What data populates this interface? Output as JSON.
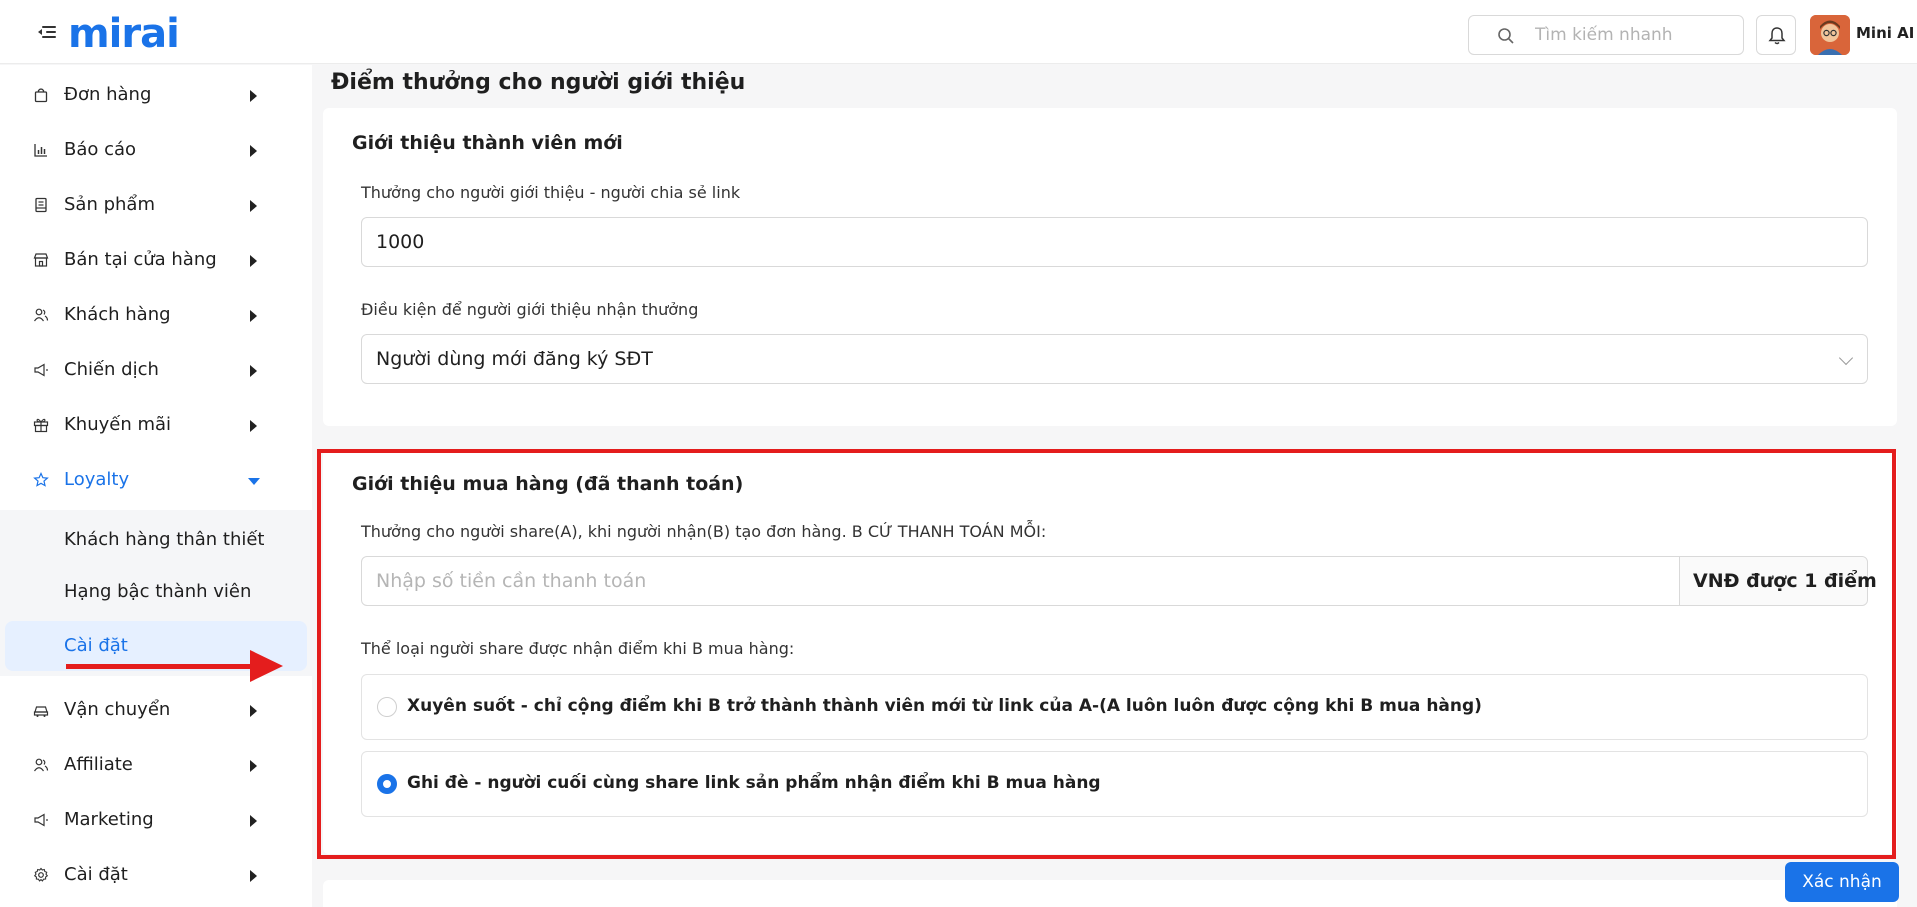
{
  "header": {
    "logo_text": "mirai",
    "search_placeholder": "Tìm kiếm nhanh",
    "user_name": "Mini AI"
  },
  "sidebar": {
    "items": [
      {
        "label": "Đơn hàng",
        "icon": "bag-icon"
      },
      {
        "label": "Báo cáo",
        "icon": "chart-icon"
      },
      {
        "label": "Sản phẩm",
        "icon": "book-icon"
      },
      {
        "label": "Bán tại cửa hàng",
        "icon": "store-icon"
      },
      {
        "label": "Khách hàng",
        "icon": "users-icon"
      },
      {
        "label": "Chiến dịch",
        "icon": "megaphone-icon"
      },
      {
        "label": "Khuyến mãi",
        "icon": "gift-icon"
      },
      {
        "label": "Loyalty",
        "icon": "star-icon"
      },
      {
        "label": "Vận chuyển",
        "icon": "car-icon"
      },
      {
        "label": "Affiliate",
        "icon": "users-icon"
      },
      {
        "label": "Marketing",
        "icon": "megaphone-icon"
      },
      {
        "label": "Cài đặt",
        "icon": "gear-icon"
      }
    ],
    "loyalty_sub": [
      {
        "label": "Khách hàng thân thiết"
      },
      {
        "label": "Hạng bậc thành viên"
      },
      {
        "label": "Cài đặt"
      }
    ]
  },
  "main": {
    "page_title": "Điểm thưởng cho người giới thiệu",
    "card1": {
      "title": "Giới thiệu thành viên mới",
      "reward_label": "Thưởng cho người giới thiệu - người chia sẻ link",
      "reward_value": "1000",
      "condition_label": "Điều kiện để người giới thiệu nhận thưởng",
      "condition_value": "Người dùng mới đăng ký SĐT"
    },
    "card2": {
      "title": "Giới thiệu mua hàng (đã thanh toán)",
      "payment_label": "Thưởng cho người share(A), khi người nhận(B) tạo đơn hàng. B CỨ THANH TOÁN MỖI:",
      "payment_placeholder": "Nhập số tiền cần thanh toán",
      "payment_addon": "VNĐ được 1 điểm",
      "type_label": "Thể loại người share được nhận điểm khi B mua hàng:",
      "options": [
        {
          "label": "Xuyên suốt - chỉ cộng điểm khi B trở thành thành viên mới từ link của A-(A luôn luôn được cộng khi B mua hàng)",
          "checked": false
        },
        {
          "label": "Ghi đè - người cuối cùng share link sản phẩm nhận điểm khi B mua hàng",
          "checked": true
        }
      ]
    },
    "submit_label": "Xác nhận"
  },
  "colors": {
    "accent": "#1a73e8",
    "highlight": "#e41d1d"
  }
}
